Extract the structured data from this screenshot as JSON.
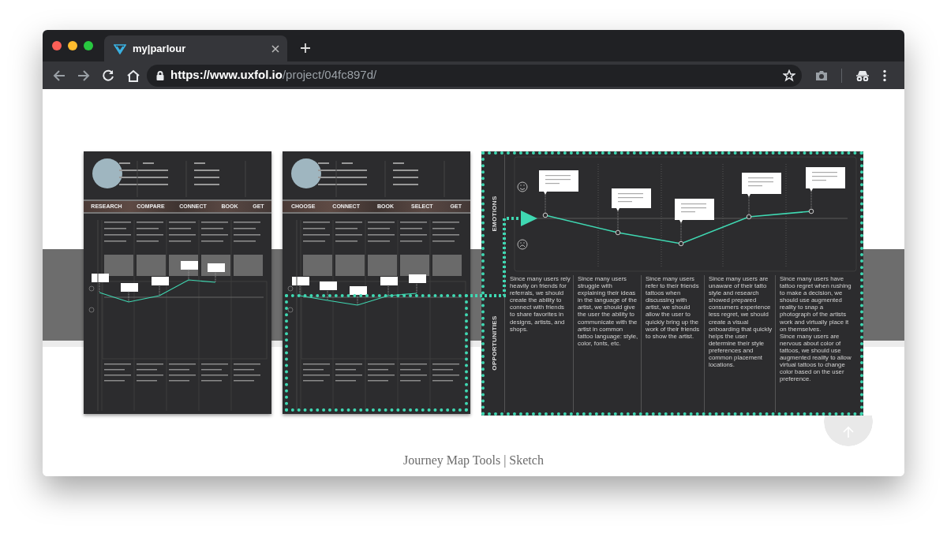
{
  "browser": {
    "tab_title": "my|parlour",
    "url_host": "https://www.uxfol.io",
    "url_path": "/project/04fc897d/"
  },
  "maps": [
    {
      "stages": [
        "RESEARCH",
        "COMPARE",
        "CONNECT",
        "BOOK",
        "GET"
      ],
      "highlighted": false
    },
    {
      "stages": [
        "CHOOSE",
        "CONNECT",
        "BOOK",
        "SELECT",
        "GET"
      ],
      "highlighted": true
    }
  ],
  "detail": {
    "emotions_label": "EMOTIONS",
    "opportunities_label": "OPPORTUNITIES",
    "opportunities": [
      [
        "Since many users rely heavily on friends for referrals, we should create the ability to connect with friends to share favorites in designs, artists, and shops."
      ],
      [
        "Since many users struggle with explaining their ideas in the language of the artist, we should give the user the ability to communicate with the artist in common tattoo language: style, color, fonts, etc."
      ],
      [
        "Since many users refer to their friends tattoos when discussing with artist, we should allow the user to quickly bring up the work of their friends to show the artist."
      ],
      [
        "Since many users are unaware of their tatto style and research showed prepared consumers experience less regret, we should create a visual onboarding that quickly helps the user determine their style preferences and common placement locations."
      ],
      [
        "Since many users have tattoo regret when rushing to make a decision, we should use augmented reality to snap a photograph of the artists work and virtually place it on themselves.",
        "Since many users are nervous about color of tattoos, we should use augmented reality to allow virtual tattoos to change color based on the user preference."
      ]
    ]
  },
  "caption": "Journey Map Tools | Sketch"
}
